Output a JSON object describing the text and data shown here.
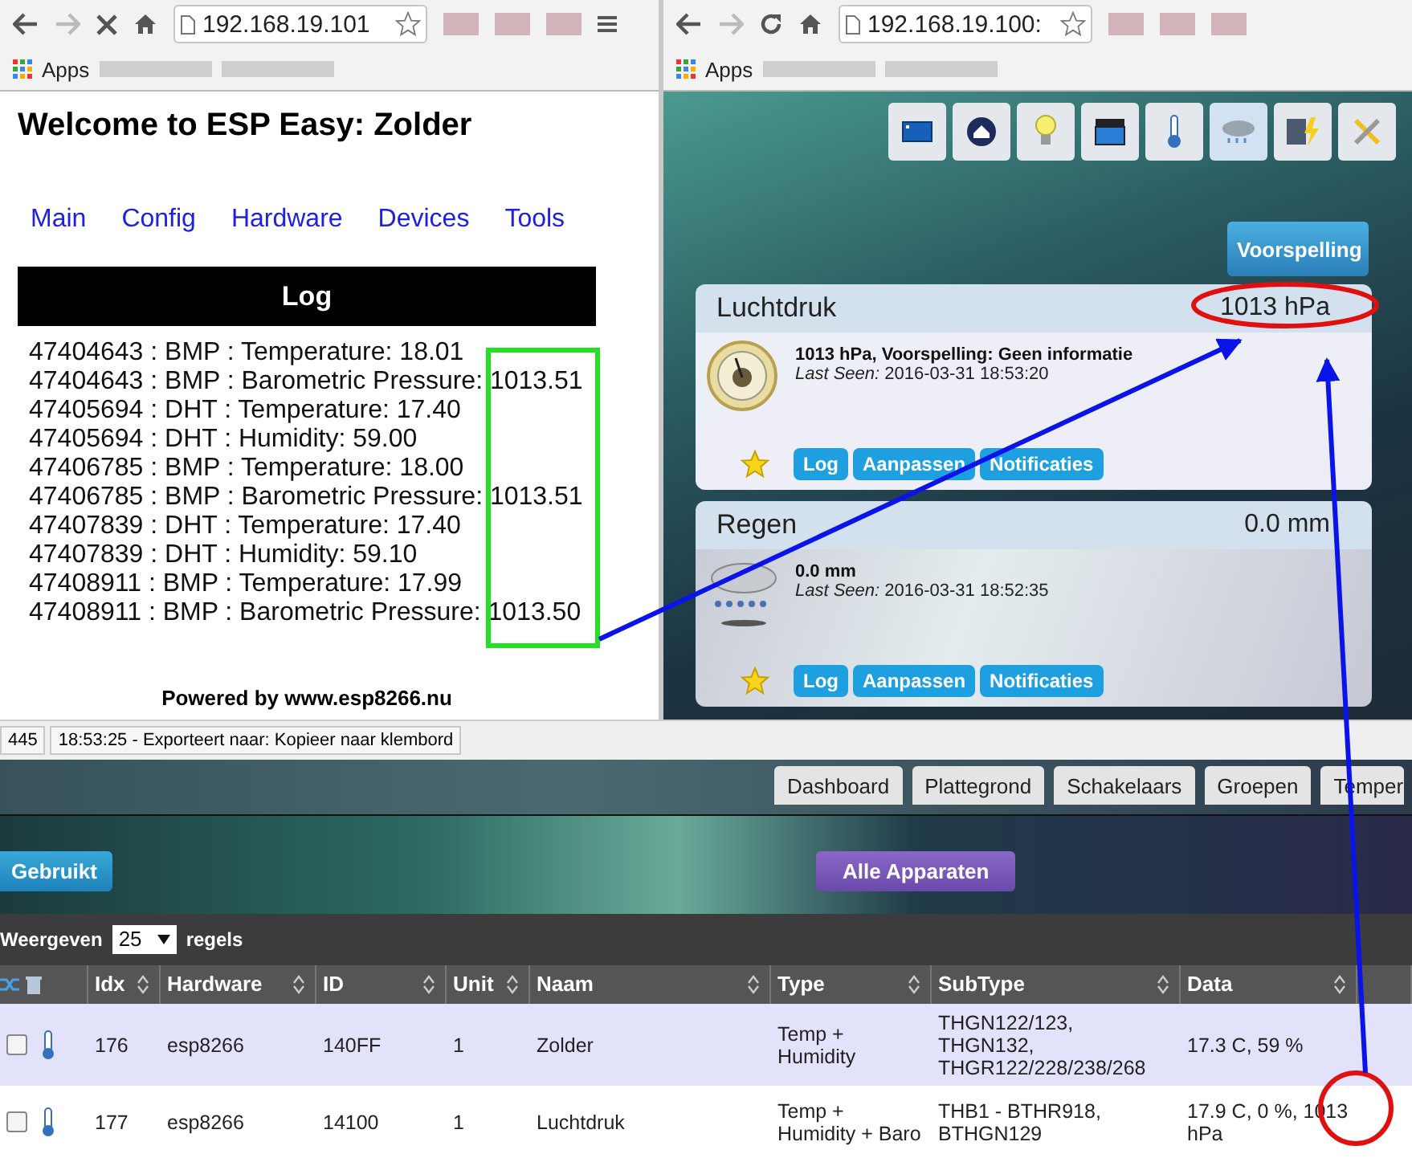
{
  "left_browser": {
    "loading": true,
    "address": "192.168.19.101",
    "apps": "Apps",
    "page": {
      "title": "Welcome to ESP Easy: Zolder",
      "nav": [
        "Main",
        "Config",
        "Hardware",
        "Devices",
        "Tools"
      ],
      "log_header": "Log",
      "log_lines": [
        "47404643 : BMP : Temperature: 18.01",
        "47404643 : BMP : Barometric Pressure: 1013.51",
        "47405694 : DHT : Temperature: 17.40",
        "47405694 : DHT : Humidity: 59.00",
        "47406785 : BMP : Temperature: 18.00",
        "47406785 : BMP : Barometric Pressure: 1013.51",
        "47407839 : DHT : Temperature: 17.40",
        "47407839 : DHT : Humidity: 59.10",
        "47408911 : BMP : Temperature: 17.99",
        "47408911 : BMP : Barometric Pressure: 1013.50"
      ],
      "footer": "Powered by www.esp8266.nu"
    }
  },
  "right_browser": {
    "loading": false,
    "address": "192.168.19.100:",
    "apps": "Apps",
    "page": {
      "toolbar": [
        {
          "kind": "screen",
          "selected": false
        },
        {
          "kind": "house",
          "selected": false
        },
        {
          "kind": "bulb",
          "selected": false
        },
        {
          "kind": "clapper",
          "selected": false
        },
        {
          "kind": "thermometer",
          "selected": false
        },
        {
          "kind": "cloud",
          "selected": true
        },
        {
          "kind": "server",
          "selected": false
        },
        {
          "kind": "tools",
          "selected": false
        }
      ],
      "forecast_button": "Voorspelling",
      "cards": [
        {
          "kind": "barometer",
          "name": "Luchtdruk",
          "value": "1013 hPa",
          "detail": "1013 hPa, Voorspelling: Geen informatie",
          "last_seen": "*Last Seen:* 2016-03-31 18:53:20",
          "buttons": [
            "Log",
            "Aanpassen",
            "Notificaties"
          ]
        },
        {
          "kind": "rain",
          "name": "Regen",
          "value": "0.0 mm",
          "detail": "0.0 mm",
          "last_seen": "*Last Seen:* 2016-03-31 18:52:35",
          "buttons": [
            "Log",
            "Aanpassen",
            "Notificaties"
          ]
        }
      ]
    }
  },
  "status_bar": {
    "panes": [
      "445",
      "18:53:25 - Exporteert naar: Kopieer naar klembord"
    ]
  },
  "dashboard": {
    "tabs": [
      "Dashboard",
      "Plattegrond",
      "Schakelaars",
      "Groepen",
      "Temper"
    ],
    "used_button": "Gebruikt",
    "all_devices_button": "Alle Apparaten",
    "show": {
      "prefix": "Weergeven",
      "value": "25",
      "suffix": "regels"
    },
    "table": {
      "columns": [
        "Idx",
        "Hardware",
        "ID",
        "Unit",
        "Naam",
        "Type",
        "SubType",
        "Data"
      ],
      "rows": [
        {
          "selected": true,
          "checked": false,
          "cells": [
            "176",
            "esp8266",
            "140FF",
            "1",
            "Zolder",
            "Temp + Humidity",
            "THGN122/123, THGN132, THGR122/228/238/268",
            "17.3 C, 59 %"
          ]
        },
        {
          "selected": false,
          "checked": false,
          "cells": [
            "177",
            "esp8266",
            "14100",
            "1",
            "Luchtdruk",
            "Temp + Humidity + Baro",
            "THB1 - BTHR918, BTHGN129",
            "17.9 C, 0 %, 1013 hPa"
          ]
        }
      ]
    }
  }
}
